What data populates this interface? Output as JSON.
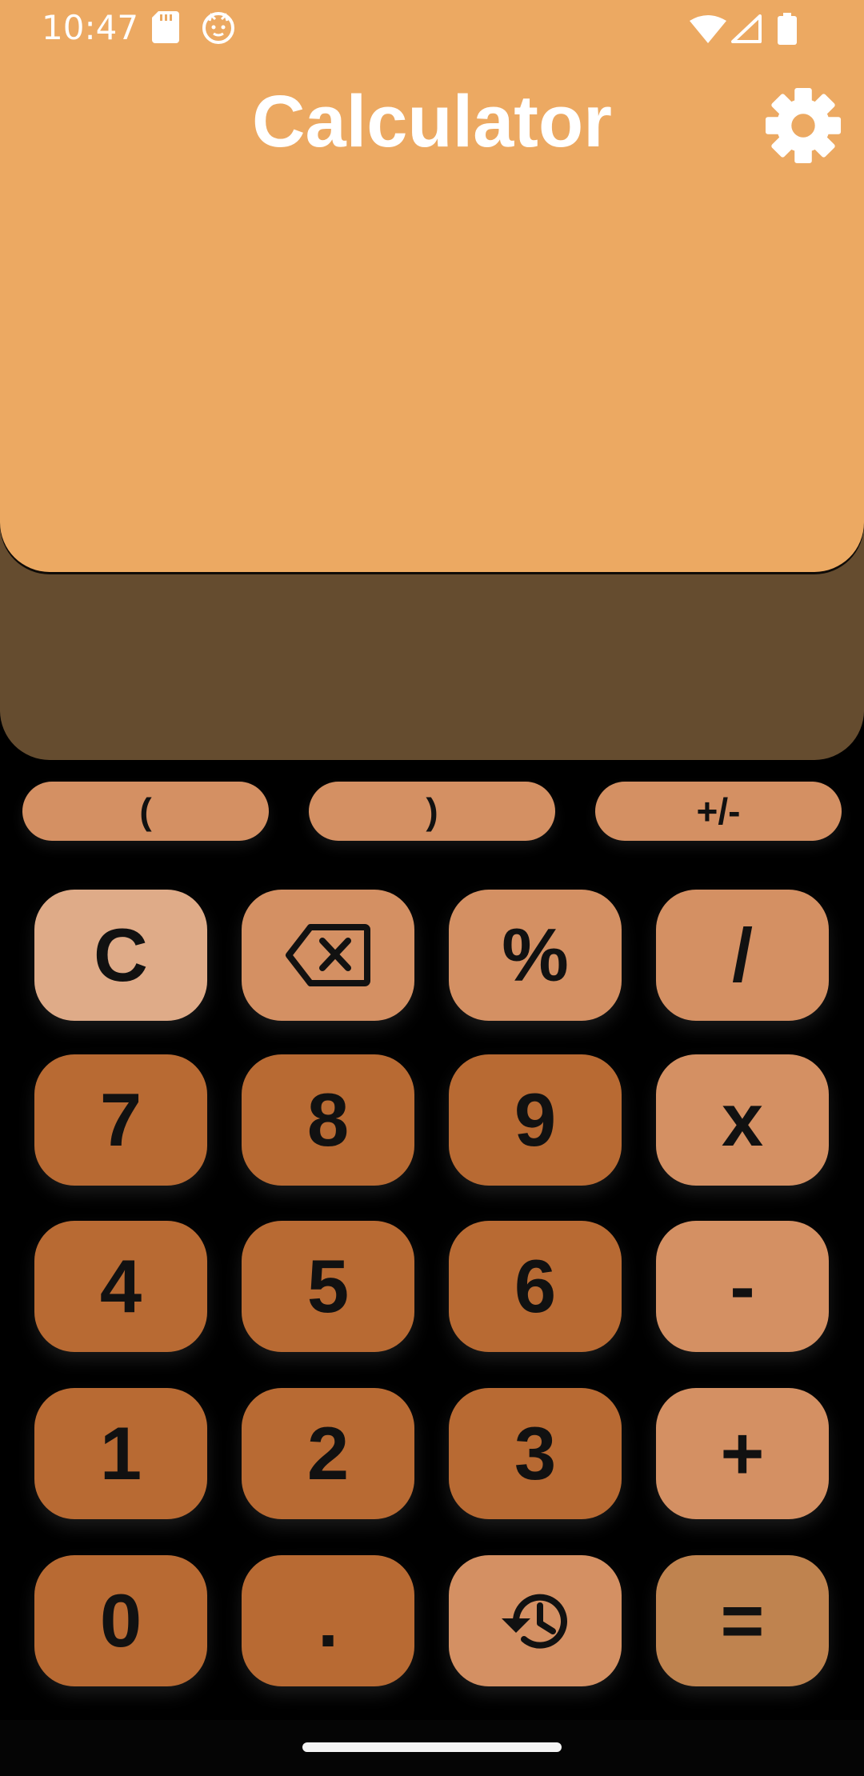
{
  "status_bar": {
    "time": "10:47",
    "icons": [
      "sd-card-icon",
      "cat-face-icon",
      "wifi-icon",
      "cellular-signal-icon",
      "battery-icon"
    ]
  },
  "header": {
    "title": "Calculator",
    "settings_icon": "gear-icon"
  },
  "pills": [
    "(",
    ")",
    "+/-"
  ],
  "keypad": {
    "clear": "C",
    "backspace_icon": "backspace-icon",
    "percent": "%",
    "divide": "/",
    "seven": "7",
    "eight": "8",
    "nine": "9",
    "multiply": "x",
    "four": "4",
    "five": "5",
    "six": "6",
    "minus": "-",
    "one": "1",
    "two": "2",
    "three": "3",
    "plus": "+",
    "zero": "0",
    "decimal": ".",
    "history_icon": "history-icon",
    "equals": "="
  },
  "colors": {
    "display_top": "#eca962",
    "display_bottom": "#654c2f",
    "key_number": "#b86a33",
    "key_operator": "#d49063",
    "key_clear": "#dfab88",
    "key_equals": "#bf834f",
    "background": "#000000"
  }
}
